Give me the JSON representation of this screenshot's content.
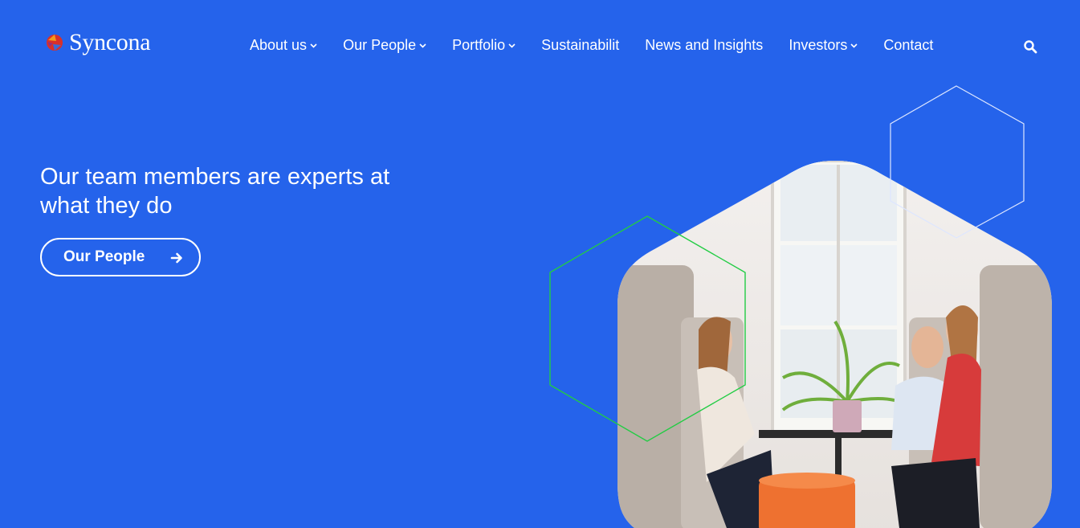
{
  "brand": {
    "name": "Syncona"
  },
  "nav": {
    "items": [
      {
        "label": "About us",
        "has_dropdown": true
      },
      {
        "label": "Our People",
        "has_dropdown": true
      },
      {
        "label": "Portfolio",
        "has_dropdown": true
      },
      {
        "label": "Sustainabilit",
        "has_dropdown": false
      },
      {
        "label": "News and Insights",
        "has_dropdown": false
      },
      {
        "label": "Investors",
        "has_dropdown": true
      },
      {
        "label": "Contact",
        "has_dropdown": false
      }
    ],
    "search_icon": "search-icon"
  },
  "hero": {
    "title": "Our team members are experts at what they do",
    "cta_label": "Our People",
    "cta_icon": "arrow-right-icon"
  },
  "colors": {
    "background": "#2563EB",
    "text": "#FFFFFF",
    "hexagon_outline_green": "#22CC44",
    "hexagon_outline_white": "#DDE6FF"
  }
}
